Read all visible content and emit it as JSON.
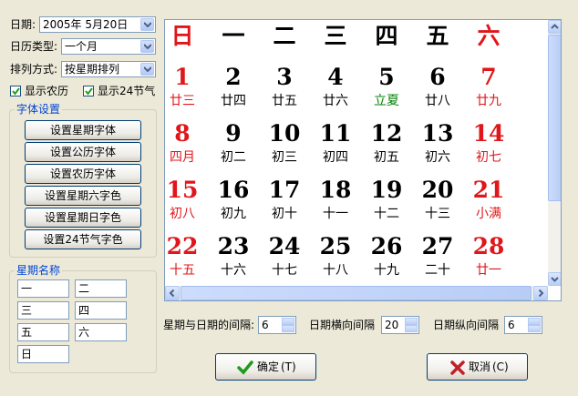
{
  "form": {
    "date_label": "日期:",
    "date_value": "2005年 5月20日",
    "caltype_label": "日历类型:",
    "caltype_value": "一个月",
    "arrange_label": "排列方式:",
    "arrange_value": "按星期排列",
    "show_lunar": "显示农历",
    "show_solar_terms": "显示24节气"
  },
  "font_group": {
    "title": "字体设置",
    "buttons": [
      "设置星期字体",
      "设置公历字体",
      "设置农历字体",
      "设置星期六字色",
      "设置星期日字色",
      "设置24节气字色"
    ]
  },
  "week_group": {
    "title": "星期名称",
    "names": [
      "一",
      "二",
      "三",
      "四",
      "五",
      "六",
      "日"
    ]
  },
  "calendar": {
    "headers": [
      "日",
      "一",
      "二",
      "三",
      "四",
      "五",
      "六"
    ],
    "rows": [
      [
        {
          "d": "1",
          "l": "廿三"
        },
        {
          "d": "2",
          "l": "廿四"
        },
        {
          "d": "3",
          "l": "廿五"
        },
        {
          "d": "4",
          "l": "廿六"
        },
        {
          "d": "5",
          "l": "立夏"
        },
        {
          "d": "6",
          "l": "廿八"
        },
        {
          "d": "7",
          "l": "廿九"
        }
      ],
      [
        {
          "d": "8",
          "l": "四月"
        },
        {
          "d": "9",
          "l": "初二"
        },
        {
          "d": "10",
          "l": "初三"
        },
        {
          "d": "11",
          "l": "初四"
        },
        {
          "d": "12",
          "l": "初五"
        },
        {
          "d": "13",
          "l": "初六"
        },
        {
          "d": "14",
          "l": "初七"
        }
      ],
      [
        {
          "d": "15",
          "l": "初八"
        },
        {
          "d": "16",
          "l": "初九"
        },
        {
          "d": "17",
          "l": "初十"
        },
        {
          "d": "18",
          "l": "十一"
        },
        {
          "d": "19",
          "l": "十二"
        },
        {
          "d": "20",
          "l": "十三"
        },
        {
          "d": "21",
          "l": "小满"
        }
      ],
      [
        {
          "d": "22",
          "l": "十五"
        },
        {
          "d": "23",
          "l": "十六"
        },
        {
          "d": "24",
          "l": "十七"
        },
        {
          "d": "25",
          "l": "十八"
        },
        {
          "d": "26",
          "l": "十九"
        },
        {
          "d": "27",
          "l": "二十"
        },
        {
          "d": "28",
          "l": "廿一"
        }
      ]
    ]
  },
  "spacing": {
    "week_date_label": "星期与日期的间隔:",
    "week_date_value": "6",
    "horiz_label": "日期横向间隔",
    "horiz_value": "20",
    "vert_label": "日期纵向间隔",
    "vert_value": "6"
  },
  "actions": {
    "ok_label": "确定",
    "ok_key": "(T)",
    "cancel_label": "取消",
    "cancel_key": "(C)"
  },
  "colors": {
    "weekend_red": "#e0161a",
    "solar_term_green": "#008000",
    "group_title_blue": "#0046d5"
  },
  "icons": {
    "ok": "check-icon",
    "cancel": "x-icon"
  }
}
